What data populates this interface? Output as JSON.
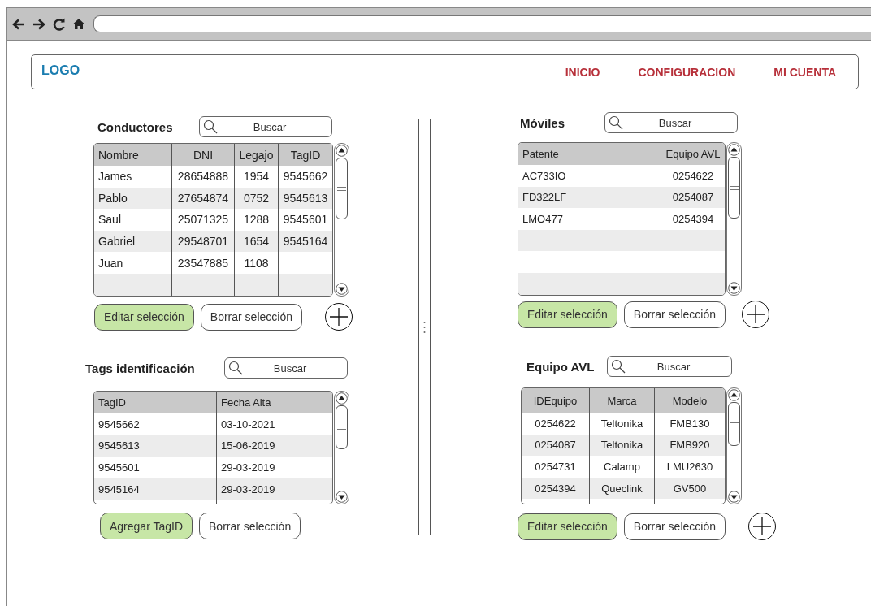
{
  "header": {
    "logo": "LOGO",
    "nav": [
      {
        "label": "INICIO"
      },
      {
        "label": "CONFIGURACION"
      },
      {
        "label": "MI CUENTA"
      }
    ]
  },
  "panels": [
    {
      "title": "Conductores",
      "search": {
        "placeholder": "Buscar"
      },
      "columns": [
        "Nombre",
        "DNI",
        "Legajo",
        "TagID"
      ],
      "rows": [
        [
          "James",
          "28654888",
          "1954",
          "9545662"
        ],
        [
          "Pablo",
          "27654874",
          "0752",
          "9545613"
        ],
        [
          "Saul",
          "25071325",
          "1288",
          "9545601"
        ],
        [
          "Gabriel",
          "29548701",
          "1654",
          "9545164"
        ],
        [
          "Juan",
          "23547885",
          "1108",
          null
        ]
      ],
      "buttons": [
        {
          "label": "Editar selección",
          "primary": true
        },
        {
          "label": "Borrar selección",
          "primary": false
        }
      ],
      "add_button": true
    },
    {
      "title": "Móviles",
      "search": {
        "placeholder": "Buscar"
      },
      "columns": [
        "Patente",
        "Equipo AVL"
      ],
      "rows": [
        [
          "AC733IO",
          "0254622"
        ],
        [
          "FD322LF",
          "0254087"
        ],
        [
          "LMO477",
          "0254394"
        ]
      ],
      "buttons": [
        {
          "label": "Editar selección",
          "primary": true
        },
        {
          "label": "Borrar selección",
          "primary": false
        }
      ],
      "add_button": true
    },
    {
      "title": "Tags identificación",
      "search": {
        "placeholder": "Buscar"
      },
      "columns": [
        "TagID",
        "Fecha Alta"
      ],
      "rows": [
        [
          "9545662",
          "03-10-2021"
        ],
        [
          "9545613",
          "15-06-2019"
        ],
        [
          "9545601",
          "29-03-2019"
        ],
        [
          "9545164",
          "29-03-2019"
        ]
      ],
      "buttons": [
        {
          "label": "Agregar TagID",
          "primary": true
        },
        {
          "label": "Borrar selección",
          "primary": false
        }
      ]
    },
    {
      "title": "Equipo AVL",
      "search": {
        "placeholder": "Buscar"
      },
      "columns": [
        "IDEquipo",
        "Marca",
        "Modelo"
      ],
      "rows": [
        [
          "0254622",
          "Teltonika",
          "FMB130"
        ],
        [
          "0254087",
          "Teltonika",
          "FMB920"
        ],
        [
          "0254731",
          "Calamp",
          "LMU2630"
        ],
        [
          "0254394",
          "Queclink",
          "GV500"
        ]
      ],
      "buttons": [
        {
          "label": "Editar selección",
          "primary": true
        },
        {
          "label": "Borrar selección",
          "primary": false
        }
      ],
      "add_button": true
    }
  ]
}
